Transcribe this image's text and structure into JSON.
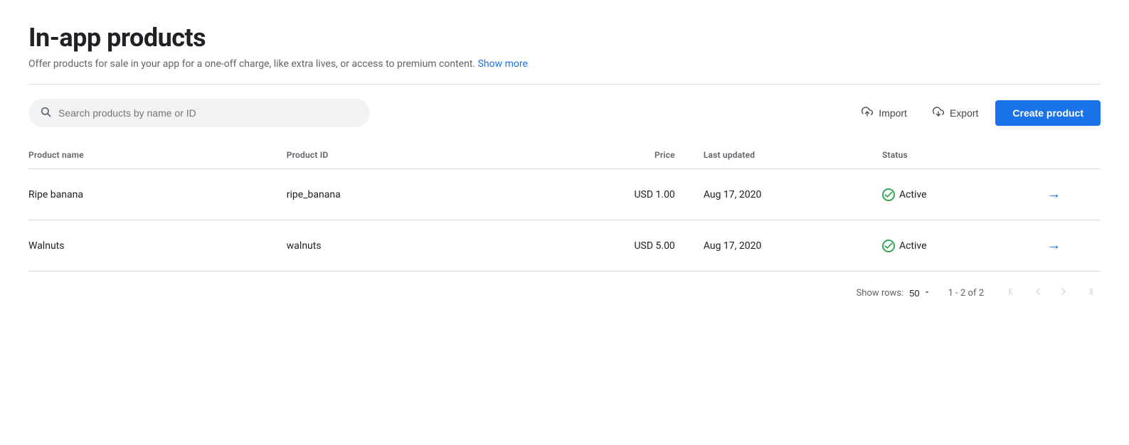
{
  "page": {
    "title": "In-app products",
    "subtitle": "Offer products for sale in your app for a one-off charge, like extra lives, or access to premium content.",
    "show_more_label": "Show more"
  },
  "toolbar": {
    "search_placeholder": "Search products by name or ID",
    "import_label": "Import",
    "export_label": "Export",
    "create_label": "Create product"
  },
  "table": {
    "columns": [
      {
        "key": "name",
        "label": "Product name"
      },
      {
        "key": "id",
        "label": "Product ID"
      },
      {
        "key": "price",
        "label": "Price"
      },
      {
        "key": "updated",
        "label": "Last updated"
      },
      {
        "key": "status",
        "label": "Status"
      }
    ],
    "rows": [
      {
        "name": "Ripe banana",
        "product_id": "ripe_banana",
        "price": "USD 1.00",
        "last_updated": "Aug 17, 2020",
        "status": "Active"
      },
      {
        "name": "Walnuts",
        "product_id": "walnuts",
        "price": "USD 5.00",
        "last_updated": "Aug 17, 2020",
        "status": "Active"
      }
    ]
  },
  "footer": {
    "show_rows_label": "Show rows:",
    "rows_per_page": "50",
    "pagination_info": "1 - 2 of 2"
  }
}
